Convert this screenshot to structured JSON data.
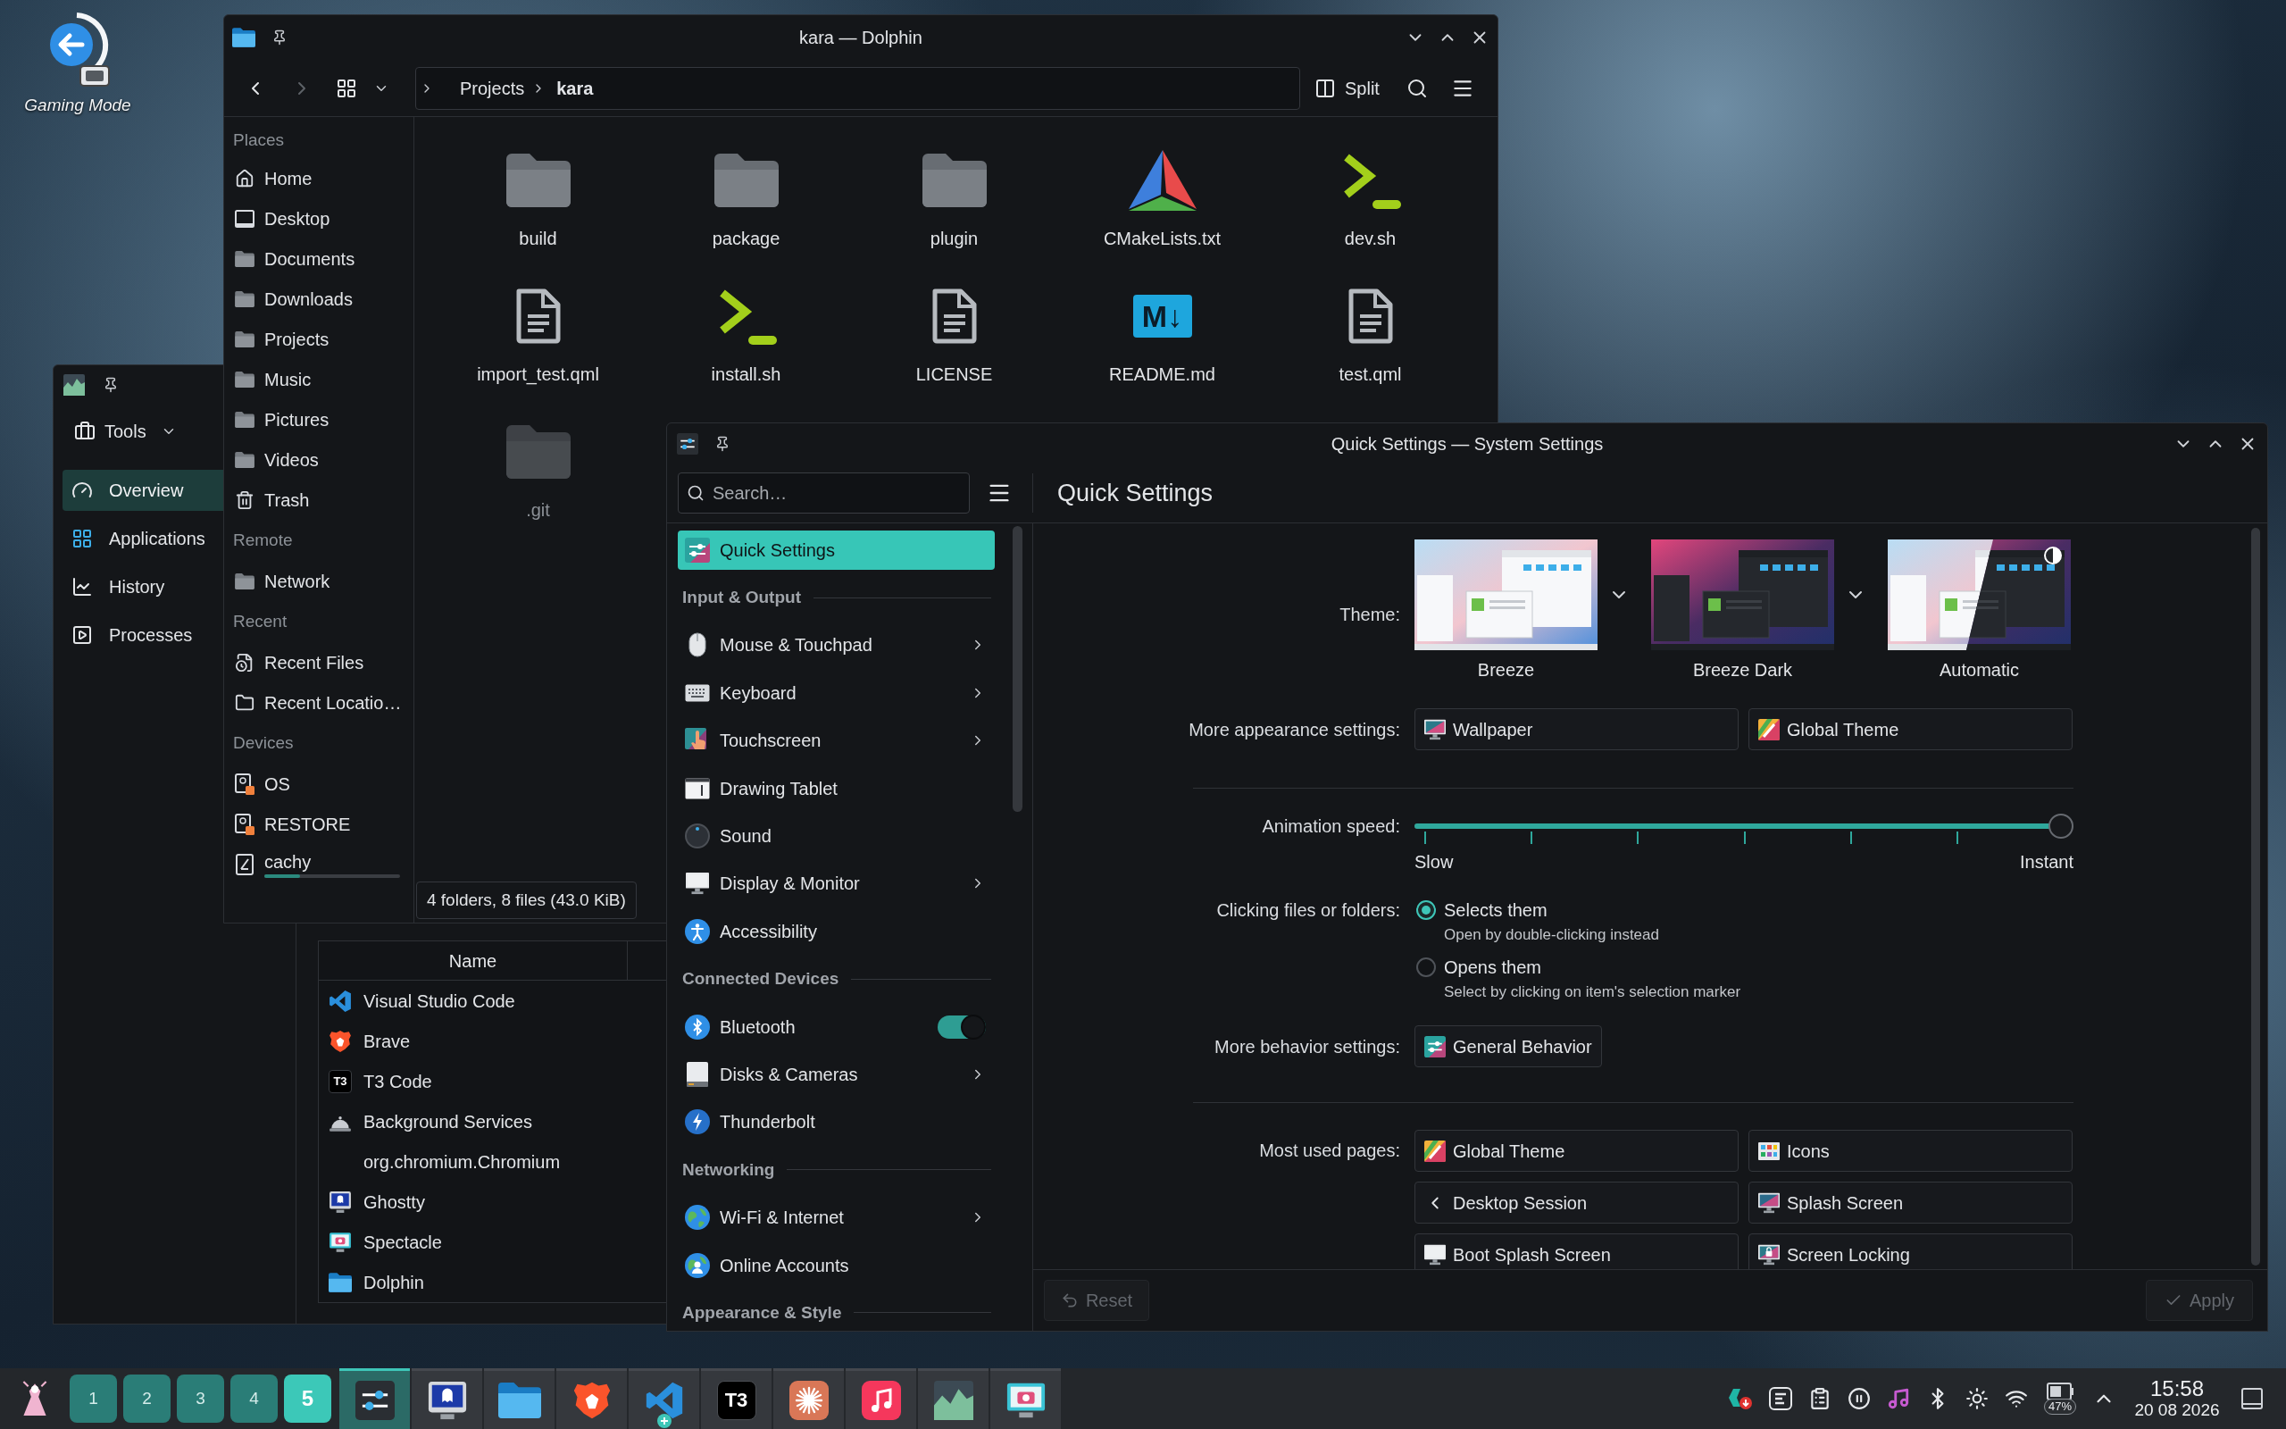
{
  "desktop_shortcuts": [
    {
      "label": "Gaming Mode"
    }
  ],
  "system_monitor": {
    "menu_button": "Tools",
    "sidebar": [
      {
        "label": "Overview",
        "selected": true
      },
      {
        "label": "Applications",
        "selected": false
      },
      {
        "label": "History",
        "selected": false
      },
      {
        "label": "Processes",
        "selected": false
      }
    ],
    "table": {
      "columns": [
        "Name"
      ],
      "rows": [
        {
          "name": "Visual Studio Code"
        },
        {
          "name": "Brave"
        },
        {
          "name": "T3 Code",
          "icon_text": "T3"
        },
        {
          "name": "Background Services"
        },
        {
          "name": "org.chromium.Chromium"
        },
        {
          "name": "Ghostty"
        },
        {
          "name": "Spectacle"
        },
        {
          "name": "Dolphin"
        }
      ]
    }
  },
  "file_manager": {
    "title": "kara — Dolphin",
    "navigation": [
      {
        "kind": "back",
        "disabled": false
      },
      {
        "kind": "forward",
        "disabled": true
      }
    ],
    "breadcrumb": [
      {
        "label": "Projects",
        "current": false
      },
      {
        "label": "kara",
        "current": true
      }
    ],
    "split_button": "Split",
    "places": [
      {
        "heading": "Places",
        "items": [
          {
            "label": "Home"
          },
          {
            "label": "Desktop"
          },
          {
            "label": "Documents"
          },
          {
            "label": "Downloads"
          },
          {
            "label": "Projects"
          },
          {
            "label": "Music"
          },
          {
            "label": "Pictures"
          },
          {
            "label": "Videos"
          },
          {
            "label": "Trash"
          }
        ]
      },
      {
        "heading": "Remote",
        "items": [
          {
            "label": "Network"
          }
        ]
      },
      {
        "heading": "Recent",
        "items": [
          {
            "label": "Recent Files"
          },
          {
            "label": "Recent Locatio…"
          }
        ]
      },
      {
        "heading": "Devices",
        "items": [
          {
            "label": "OS"
          },
          {
            "label": "RESTORE"
          },
          {
            "label": "cachy",
            "level": 0.26
          }
        ]
      }
    ],
    "files": [
      {
        "name": "build",
        "kind": "folder",
        "hidden": false
      },
      {
        "name": "package",
        "kind": "folder",
        "hidden": false
      },
      {
        "name": "plugin",
        "kind": "folder",
        "hidden": false
      },
      {
        "name": "CMakeLists.txt",
        "kind": "cmake",
        "hidden": false
      },
      {
        "name": "dev.sh",
        "kind": "script",
        "hidden": false
      },
      {
        "name": "import_test.qml",
        "kind": "document",
        "hidden": false
      },
      {
        "name": "install.sh",
        "kind": "script",
        "hidden": false
      },
      {
        "name": "LICENSE",
        "kind": "document",
        "hidden": false
      },
      {
        "name": "README.md",
        "kind": "markdown",
        "icon_text": "M↓",
        "hidden": false
      },
      {
        "name": "test.qml",
        "kind": "document",
        "hidden": false
      },
      {
        "name": ".git",
        "kind": "folder",
        "hidden": true
      }
    ],
    "status": "4 folders, 8 files (43.0 KiB)"
  },
  "system_settings": {
    "title": "Quick Settings — System Settings",
    "search": {
      "placeholder": "Search…"
    },
    "page_title": "Quick Settings",
    "sidebar": [
      {
        "items": [
          {
            "label": "Quick Settings",
            "kind": "page",
            "chevron": false,
            "selected": true
          }
        ]
      },
      {
        "heading": "Input & Output",
        "items": [
          {
            "label": "Mouse & Touchpad",
            "kind": "page",
            "chevron": true,
            "selected": false
          },
          {
            "label": "Keyboard",
            "kind": "page",
            "chevron": true,
            "selected": false
          },
          {
            "label": "Touchscreen",
            "kind": "page",
            "chevron": true,
            "selected": false
          },
          {
            "label": "Drawing Tablet",
            "kind": "page",
            "chevron": false,
            "selected": false
          },
          {
            "label": "Sound",
            "kind": "page",
            "chevron": false,
            "selected": false
          },
          {
            "label": "Display & Monitor",
            "kind": "page",
            "chevron": true,
            "selected": false
          },
          {
            "label": "Accessibility",
            "kind": "page",
            "chevron": false,
            "selected": false
          }
        ]
      },
      {
        "heading": "Connected Devices",
        "items": [
          {
            "label": "Bluetooth",
            "kind": "switch",
            "on": true,
            "selected": false
          },
          {
            "label": "Disks & Cameras",
            "kind": "page",
            "chevron": true,
            "selected": false
          },
          {
            "label": "Thunderbolt",
            "kind": "page",
            "chevron": false,
            "selected": false
          }
        ]
      },
      {
        "heading": "Networking",
        "items": [
          {
            "label": "Wi-Fi & Internet",
            "kind": "page",
            "chevron": true,
            "selected": false
          },
          {
            "label": "Online Accounts",
            "kind": "page",
            "chevron": false,
            "selected": false
          }
        ]
      },
      {
        "heading": "Appearance & Style"
      }
    ],
    "theme": {
      "label": "Theme:",
      "options": [
        {
          "label": "Breeze",
          "kind": "light",
          "menu": true
        },
        {
          "label": "Breeze Dark",
          "kind": "dark",
          "menu": true
        },
        {
          "label": "Automatic",
          "kind": "automatic",
          "menu": false
        }
      ]
    },
    "appearance": {
      "label": "More appearance settings:",
      "buttons": [
        {
          "label": "Wallpaper"
        },
        {
          "label": "Global Theme"
        }
      ]
    },
    "animation": {
      "label": "Animation speed:",
      "level": 1,
      "min_label": "Slow",
      "max_label": "Instant"
    },
    "clicking": {
      "label": "Clicking files or folders:",
      "options": [
        {
          "label": "Selects them",
          "hint": "Open by double-clicking instead",
          "selected": true
        },
        {
          "label": "Opens them",
          "hint": "Select by clicking on item's selection marker",
          "selected": false
        }
      ]
    },
    "behavior": {
      "label": "More behavior settings:",
      "buttons": [
        {
          "label": "General Behavior"
        }
      ]
    },
    "most_used": {
      "label": "Most used pages:",
      "buttons": [
        {
          "label": "Global Theme"
        },
        {
          "label": "Icons"
        },
        {
          "label": "Desktop Session"
        },
        {
          "label": "Splash Screen"
        },
        {
          "label": "Boot Splash Screen"
        },
        {
          "label": "Screen Locking"
        }
      ]
    },
    "footer": {
      "reset": {
        "label": "Reset",
        "disabled": true
      },
      "apply": {
        "label": "Apply",
        "disabled": true
      }
    }
  },
  "taskbar": {
    "pager": [
      {
        "label": "1",
        "selected": false
      },
      {
        "label": "2",
        "selected": false
      },
      {
        "label": "3",
        "selected": false
      },
      {
        "label": "4",
        "selected": false
      },
      {
        "label": "5",
        "selected": true
      }
    ],
    "tasks": [
      {
        "selected": true,
        "badge": false
      },
      {
        "selected": false,
        "badge": false
      },
      {
        "selected": false,
        "badge": false
      },
      {
        "selected": false,
        "badge": false
      },
      {
        "selected": false,
        "badge": true
      },
      {
        "selected": false,
        "badge": false,
        "icon_text": "T3"
      },
      {
        "selected": false,
        "badge": false
      },
      {
        "selected": false,
        "badge": false
      },
      {
        "selected": false,
        "badge": false
      },
      {
        "selected": false,
        "badge": false
      }
    ],
    "battery": "47%",
    "clock": {
      "time": "15:58",
      "date": "20 08 2026"
    }
  }
}
